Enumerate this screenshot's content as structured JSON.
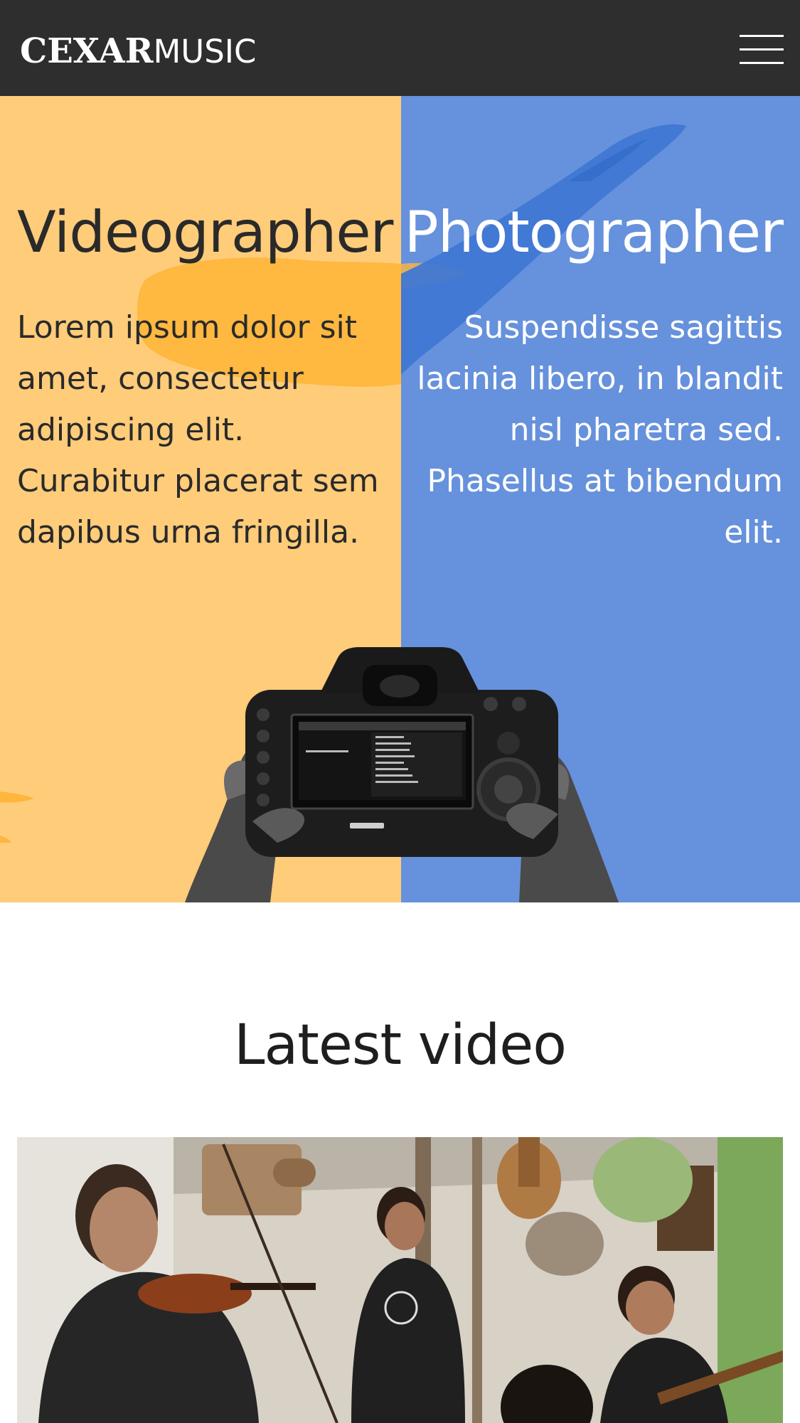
{
  "header": {
    "logo_bold": "CEXAR",
    "logo_light": "MUSIC",
    "menu_icon": "hamburger-menu-icon",
    "background": "#2e2e2e"
  },
  "hero": {
    "left": {
      "title": "Videographer",
      "text": "Lorem ipsum dolor sit amet, consectetur adipiscing elit. Curabitur placerat sem dapibus urna fringilla.",
      "background": "#ffcc7a",
      "brush_color": "#ffb63d"
    },
    "right": {
      "title": "Photographer",
      "text": "Suspendisse sagittis lacinia libero, in blandit nisl pharetra sed. Phasellus at bibendum elit.",
      "background": "#6691dc",
      "brush_color": "#3f78d3"
    },
    "image": "camera-in-hands-image"
  },
  "latest_video": {
    "title": "Latest video",
    "thumbnail": "musicians-playing-video-thumbnail"
  }
}
